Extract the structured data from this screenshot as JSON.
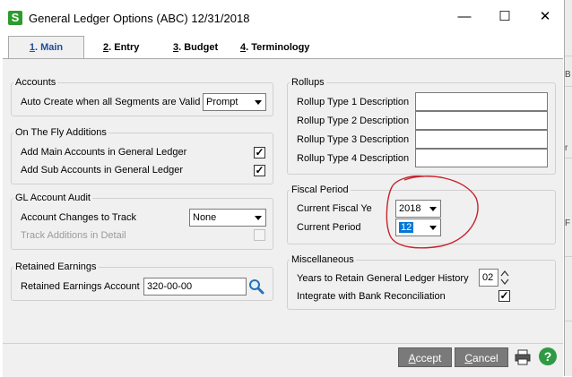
{
  "window": {
    "app_icon_letter": "S",
    "title": "General Ledger Options (ABC) 12/31/2018"
  },
  "window_controls": {
    "minimize": "—",
    "maximize": "☐",
    "close": "✕"
  },
  "tabs": [
    {
      "num": "1",
      "label": ". Main"
    },
    {
      "num": "2",
      "label": ". Entry"
    },
    {
      "num": "3",
      "label": ". Budget"
    },
    {
      "num": "4",
      "label": ". Terminology"
    }
  ],
  "accounts": {
    "title": "Accounts",
    "auto_create_label": "Auto Create when all Segments are Valid",
    "auto_create_value": "Prompt"
  },
  "on_the_fly": {
    "title": "On The Fly Additions",
    "main_label": "Add Main Accounts in General Ledger",
    "sub_label": "Add Sub Accounts in General Ledger",
    "check": "✓"
  },
  "audit": {
    "title": "GL Account Audit",
    "changes_label": "Account Changes to Track",
    "changes_value": "None",
    "track_label": "Track Additions in Detail"
  },
  "retained": {
    "title": "Retained Earnings",
    "account_label": "Retained Earnings Account",
    "account_value": "320-00-00"
  },
  "rollups": {
    "title": "Rollups",
    "type1": "Rollup Type 1 Description",
    "type2": "Rollup Type 2 Description",
    "type3": "Rollup Type 3 Description",
    "type4": "Rollup Type 4 Description"
  },
  "fiscal": {
    "title": "Fiscal Period",
    "year_label": "Current Fiscal Ye",
    "year_value": "2018",
    "period_label": "Current Period",
    "period_value": "12"
  },
  "misc": {
    "title": "Miscellaneous",
    "years_label": "Years to Retain General Ledger History",
    "years_value": "02",
    "bank_label": "Integrate with Bank Reconciliation",
    "check": "✓"
  },
  "footer": {
    "accept_u": "A",
    "accept_rest": "ccept",
    "cancel_u": "C",
    "cancel_rest": "ancel",
    "help": "?"
  },
  "background_fragments": {
    "b": "B",
    "r": "r",
    "f": "F"
  },
  "colors": {
    "accent_tab": "#1d4f9c",
    "annotation": "#c8232c",
    "highlight": "#0078d7"
  }
}
